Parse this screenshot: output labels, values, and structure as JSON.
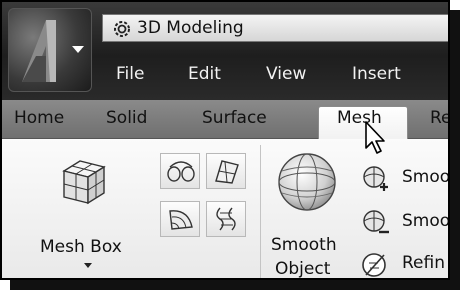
{
  "workspace": {
    "label": "3D Modeling"
  },
  "menubar": {
    "items": [
      "File",
      "Edit",
      "View",
      "Insert"
    ]
  },
  "ribbon": {
    "tabs": [
      "Home",
      "Solid",
      "Surface",
      "Mesh",
      "Re"
    ],
    "active_tab": "Mesh"
  },
  "panel": {
    "mesh_box_label": "Mesh Box",
    "smooth_object_line1": "Smooth",
    "smooth_object_line2": "Object",
    "side_buttons": [
      "Smoo",
      "Smoo",
      "Refin"
    ]
  },
  "colors": {
    "titlebar": "#222222",
    "tabs_bar": "#7a7a7a",
    "active_tab": "#ffffff",
    "panel": "#f2f2f2"
  }
}
